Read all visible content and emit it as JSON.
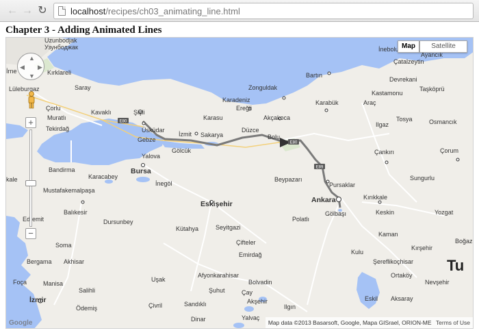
{
  "browser": {
    "url_host": "localhost",
    "url_path": "/recipes/ch03_animating_line.html"
  },
  "page": {
    "heading": "Chapter 3 - Adding Animated Lines"
  },
  "map": {
    "type_controls": [
      "Map",
      "Satellite"
    ],
    "attribution": "Map data ©2013 Basarsoft, Google, Mapa GISrael, ORION-ME",
    "terms": "Terms of Use",
    "logo_text": "Google",
    "road_shields": [
      "E80",
      "E80",
      "E89"
    ],
    "land_color": "#f0eee9",
    "water_color": "#a5c2f5",
    "route_color": "#7a7a7a",
    "labels": {
      "uzunbodjak": "Uzunbodjak",
      "uzunbodjak_cyr": "Узунбоджак",
      "inebolu": "İnebolu",
      "ayancik": "Ayancık",
      "catalzeytin": "Çatalzeytin",
      "irne": "İrne",
      "kirklareli": "Kırklareli",
      "bartin": "Bartın",
      "devrekani": "Devrekani",
      "luleburgaz": "Lüleburgaz",
      "saray": "Saray",
      "zonguldak": "Zonguldak",
      "kastamonu": "Kastamonu",
      "taskopru": "Taşköprü",
      "corlu": "Çorlu",
      "kavakli": "Kavaklı",
      "sisli": "Şişli",
      "karadeniz_eregli_1": "Karadeniz",
      "karadeniz_eregli_2": "Ereğli",
      "karabuk": "Karabük",
      "arac": "Araç",
      "muratli": "Muratlı",
      "uskudar": "Üsküdar",
      "akcakoca": "Akçakoca",
      "tosya": "Tosya",
      "tekirdag": "Tekirdağ",
      "karasu": "Karasu",
      "ilgaz": "Ilgaz",
      "osmancik": "Osmancık",
      "izmit": "İzmit",
      "sakarya": "Sakarya",
      "duzce": "Düzce",
      "bolu": "Bolu",
      "gebze": "Gebze",
      "golcuk": "Gölcük",
      "cankiri": "Çankırı",
      "corum": "Çorum",
      "yalova": "Yalova",
      "bandirma": "Bandirma",
      "bursa": "Bursa",
      "beypazari": "Beypazarı",
      "sungurlu": "Sungurlu",
      "karacabey": "Karacabey",
      "inegol": "İnegöl",
      "pursaklar": "Pursaklar",
      "kale": "kale",
      "mustafakemalpasa": "Mustafakemalpaşa",
      "eskisehir": "Eskişehir",
      "ankara": "Ankara",
      "kirikkale": "Kırıkkale",
      "balikesir": "Balıkesir",
      "polatli": "Polatlı",
      "golbasi": "Gölbaşı",
      "keskin": "Keskin",
      "yozgat": "Yozgat",
      "edremit": "Edremit",
      "dursunbey": "Dursunbey",
      "kutahya": "Kütahya",
      "seyitgazi": "Seyitgazi",
      "kaman": "Kaman",
      "soma": "Soma",
      "ciftelar": "Çifteler",
      "kirsehir": "Kırşehir",
      "bogaz": "Boğaz",
      "bergama": "Bergama",
      "akhisar": "Akhisar",
      "emirdag": "Emirdağ",
      "kulu": "Kulu",
      "serefli": "Şereflikoçhisar",
      "tu": "Tu",
      "foca": "Foça",
      "afyonkarahisar": "Afyonkarahisar",
      "ortakoy": "Ortaköy",
      "usak": "Uşak",
      "bolvadin": "Bolvadin",
      "nevsehir": "Nevşehir",
      "manisa": "Manisa",
      "salihli": "Salihli",
      "suhut": "Şuhut",
      "cay": "Çay",
      "izmir": "İzmir",
      "civril": "Çivril",
      "sandikli": "Sandıklı",
      "aksehir": "Akşehir",
      "ilgin": "Ilgın",
      "eskil": "Eskil",
      "aksaray": "Aksaray",
      "odemis": "Ödemiş",
      "dinar": "Dinar",
      "yalvac": "Yalvaç"
    }
  }
}
